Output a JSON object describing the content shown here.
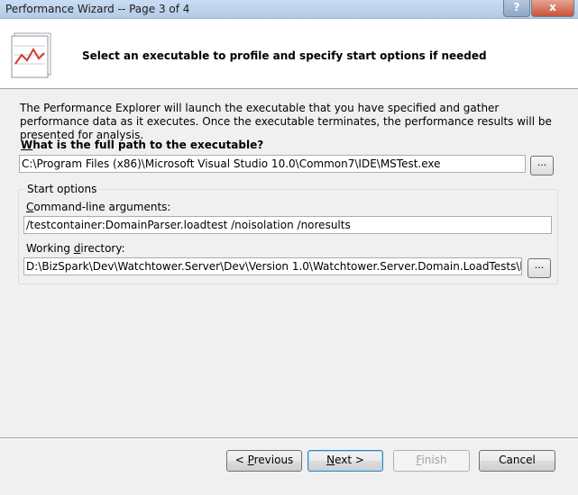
{
  "window": {
    "title": "Performance Wizard -- Page 3 of 4",
    "help_label": "?",
    "close_label": "x"
  },
  "header": {
    "text": "Select an executable to profile and specify start options if needed",
    "icon": "chart-line-icon"
  },
  "description": "The Performance Explorer will launch the executable that you have specified and gather performance data as it executes.  Once the executable terminates, the performance results will be presented for analysis.",
  "executable": {
    "label_first": "W",
    "label_rest": "hat is the full path to the executable?",
    "value": "C:\\Program Files (x86)\\Microsoft Visual Studio 10.0\\Common7\\IDE\\MSTest.exe",
    "browse_label": "..."
  },
  "start_options": {
    "group_label": "Start options",
    "args_label_first": "C",
    "args_label_rest": "ommand-line arguments:",
    "args_value": "/testcontainer:DomainParser.loadtest /noisolation /noresults",
    "workdir_label_pre": "Working ",
    "workdir_label_u": "d",
    "workdir_label_rest": "irectory:",
    "workdir_value": "D:\\BizSpark\\Dev\\Watchtower.Server\\Dev\\Version 1.0\\Watchtower.Server.Domain.LoadTests\\bin\\Release",
    "browse_label": "..."
  },
  "buttons": {
    "previous_pre": "< ",
    "previous_u": "P",
    "previous_rest": "revious",
    "next_u": "N",
    "next_rest": "ext >",
    "finish_u": "F",
    "finish_rest": "inish",
    "cancel": "Cancel"
  }
}
